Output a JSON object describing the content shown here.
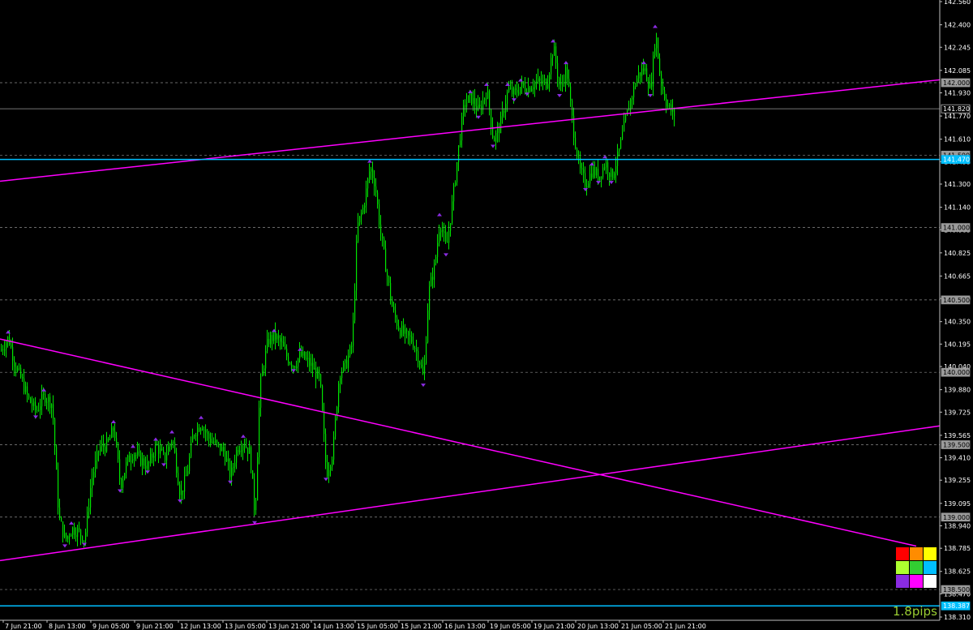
{
  "chart_data": {
    "type": "candlestick",
    "y_ticks": [
      "142.560",
      "142.400",
      "142.245",
      "142.085",
      "141.930",
      "141.770",
      "141.610",
      "141.455",
      "141.300",
      "141.140",
      "140.985",
      "140.825",
      "140.665",
      "140.510",
      "140.350",
      "140.195",
      "140.040",
      "139.880",
      "139.725",
      "139.565",
      "139.410",
      "139.255",
      "139.095",
      "138.940",
      "138.785",
      "138.625",
      "138.470",
      "138.310"
    ],
    "x_ticks": [
      "7 Jun 21:00",
      "8 Jun 13:00",
      "9 Jun 05:00",
      "9 Jun 21:00",
      "12 Jun 13:00",
      "13 Jun 05:00",
      "13 Jun 21:00",
      "14 Jun 13:00",
      "15 Jun 05:00",
      "15 Jun 21:00",
      "16 Jun 13:00",
      "19 Jun 05:00",
      "19 Jun 21:00",
      "20 Jun 13:00",
      "21 Jun 05:00",
      "21 Jun 21:00"
    ],
    "level_labels": [
      "142.000",
      "141.820",
      "141.500",
      "141.470",
      "141.000",
      "140.500",
      "140.000",
      "139.500",
      "139.000",
      "138.500",
      "138.387"
    ],
    "levels": [
      {
        "price": 142.0,
        "label": "142.000",
        "kind": "dashed"
      },
      {
        "price": 141.5,
        "label": "141.500",
        "kind": "dashed"
      },
      {
        "price": 141.0,
        "label": "141.000",
        "kind": "dashed"
      },
      {
        "price": 140.5,
        "label": "140.500",
        "kind": "dashed"
      },
      {
        "price": 140.0,
        "label": "140.000",
        "kind": "dashed"
      },
      {
        "price": 139.5,
        "label": "139.500",
        "kind": "dashed"
      },
      {
        "price": 139.0,
        "label": "139.000",
        "kind": "dashed"
      },
      {
        "price": 138.5,
        "label": "138.500",
        "kind": "dashed"
      },
      {
        "price": 141.82,
        "label": "141.820",
        "kind": "current"
      },
      {
        "price": 141.47,
        "label": "141.470",
        "kind": "cyan"
      },
      {
        "price": 138.387,
        "label": "138.387",
        "kind": "cyan"
      }
    ],
    "trendlines": [
      {
        "name": "upper-channel",
        "x1": 0,
        "y1": 141.32,
        "x2": 1159,
        "y2": 142.02
      },
      {
        "name": "descending",
        "x1": 0,
        "y1": 140.23,
        "x2": 1130,
        "y2": 138.8
      },
      {
        "name": "lower-channel",
        "x1": 0,
        "y1": 138.7,
        "x2": 1159,
        "y2": 139.63
      }
    ],
    "price_path": [
      [
        0,
        140.15
      ],
      [
        10,
        140.24
      ],
      [
        18,
        140.05
      ],
      [
        26,
        139.95
      ],
      [
        34,
        139.82
      ],
      [
        44,
        139.73
      ],
      [
        54,
        139.84
      ],
      [
        64,
        139.78
      ],
      [
        72,
        139.0
      ],
      [
        80,
        138.84
      ],
      [
        88,
        138.92
      ],
      [
        96,
        138.9
      ],
      [
        104,
        138.85
      ],
      [
        112,
        139.25
      ],
      [
        122,
        139.48
      ],
      [
        132,
        139.5
      ],
      [
        140,
        139.62
      ],
      [
        148,
        139.22
      ],
      [
        156,
        139.38
      ],
      [
        164,
        139.45
      ],
      [
        172,
        139.4
      ],
      [
        182,
        139.35
      ],
      [
        192,
        139.5
      ],
      [
        202,
        139.4
      ],
      [
        212,
        139.55
      ],
      [
        222,
        139.15
      ],
      [
        230,
        139.3
      ],
      [
        238,
        139.58
      ],
      [
        248,
        139.65
      ],
      [
        256,
        139.55
      ],
      [
        266,
        139.5
      ],
      [
        276,
        139.45
      ],
      [
        284,
        139.28
      ],
      [
        292,
        139.48
      ],
      [
        300,
        139.52
      ],
      [
        308,
        139.44
      ],
      [
        314,
        139.0
      ],
      [
        320,
        139.9
      ],
      [
        330,
        140.22
      ],
      [
        338,
        140.25
      ],
      [
        346,
        140.2
      ],
      [
        354,
        140.1
      ],
      [
        362,
        140.05
      ],
      [
        370,
        140.12
      ],
      [
        378,
        140.08
      ],
      [
        386,
        140.02
      ],
      [
        394,
        139.95
      ],
      [
        402,
        139.3
      ],
      [
        410,
        139.45
      ],
      [
        418,
        140.0
      ],
      [
        426,
        140.05
      ],
      [
        434,
        140.2
      ],
      [
        440,
        141.0
      ],
      [
        448,
        141.15
      ],
      [
        456,
        141.42
      ],
      [
        462,
        141.3
      ],
      [
        468,
        141.0
      ],
      [
        476,
        140.7
      ],
      [
        484,
        140.42
      ],
      [
        492,
        140.3
      ],
      [
        500,
        140.25
      ],
      [
        508,
        140.22
      ],
      [
        516,
        140.1
      ],
      [
        522,
        139.95
      ],
      [
        528,
        140.55
      ],
      [
        536,
        140.75
      ],
      [
        542,
        141.05
      ],
      [
        550,
        140.85
      ],
      [
        558,
        141.2
      ],
      [
        566,
        141.6
      ],
      [
        572,
        141.85
      ],
      [
        580,
        141.9
      ],
      [
        590,
        141.8
      ],
      [
        600,
        141.95
      ],
      [
        608,
        141.6
      ],
      [
        616,
        141.7
      ],
      [
        626,
        141.95
      ],
      [
        634,
        141.92
      ],
      [
        642,
        141.98
      ],
      [
        650,
        141.96
      ],
      [
        658,
        142.0
      ],
      [
        666,
        142.0
      ],
      [
        674,
        142.0
      ],
      [
        682,
        142.25
      ],
      [
        690,
        141.95
      ],
      [
        698,
        142.1
      ],
      [
        706,
        141.7
      ],
      [
        714,
        141.4
      ],
      [
        722,
        141.3
      ],
      [
        730,
        141.4
      ],
      [
        738,
        141.35
      ],
      [
        746,
        141.45
      ],
      [
        754,
        141.35
      ],
      [
        762,
        141.5
      ],
      [
        770,
        141.72
      ],
      [
        778,
        141.9
      ],
      [
        786,
        142.05
      ],
      [
        794,
        142.1
      ],
      [
        802,
        141.95
      ],
      [
        808,
        142.35
      ],
      [
        814,
        142.02
      ],
      [
        822,
        141.85
      ],
      [
        830,
        141.78
      ]
    ]
  },
  "pips_label": "1.8pips",
  "colors": {
    "background": "#000000",
    "candle": "#00e600",
    "trendline": "#ff00ff",
    "cyan_level": "#00bfff",
    "grid": "#8c8c8c",
    "current_price": "#9a9a9a",
    "fractal": "#8a2be2"
  },
  "palette": [
    "#ff0000",
    "#ff8c00",
    "#ffff00",
    "#adff2f",
    "#32cd32",
    "#00bfff",
    "#8a2be2",
    "#ff00ff",
    "#ffffff"
  ]
}
